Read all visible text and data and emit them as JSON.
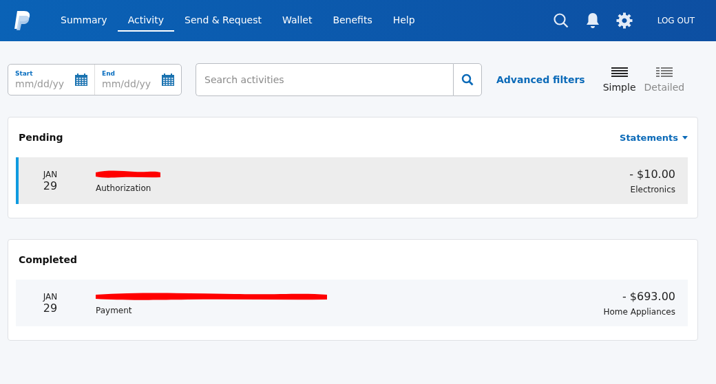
{
  "nav": {
    "items": [
      {
        "label": "Summary",
        "selected": false
      },
      {
        "label": "Activity",
        "selected": true
      },
      {
        "label": "Send & Request",
        "selected": false
      },
      {
        "label": "Wallet",
        "selected": false
      },
      {
        "label": "Benefits",
        "selected": false
      },
      {
        "label": "Help",
        "selected": false
      }
    ],
    "logout": "LOG OUT"
  },
  "filters": {
    "start": {
      "label": "Start",
      "placeholder": "mm/dd/yy"
    },
    "end": {
      "label": "End",
      "placeholder": "mm/dd/yy"
    },
    "search": {
      "placeholder": "Search activities"
    },
    "advanced": "Advanced filters",
    "views": [
      {
        "label": "Simple",
        "kind": "simple",
        "selected": true
      },
      {
        "label": "Detailed",
        "kind": "detailed",
        "selected": false
      }
    ]
  },
  "sections": [
    {
      "title": "Pending",
      "statements": "Statements",
      "rows": [
        {
          "month": "JAN",
          "day": "29",
          "type": "Authorization",
          "amount": "- $10.00",
          "category": "Electronics",
          "selected": true
        }
      ]
    },
    {
      "title": "Completed",
      "rows": [
        {
          "month": "JAN",
          "day": "29",
          "type": "Payment",
          "amount": "- $693.00",
          "category": "Home Appliances",
          "selected": false
        }
      ]
    }
  ]
}
